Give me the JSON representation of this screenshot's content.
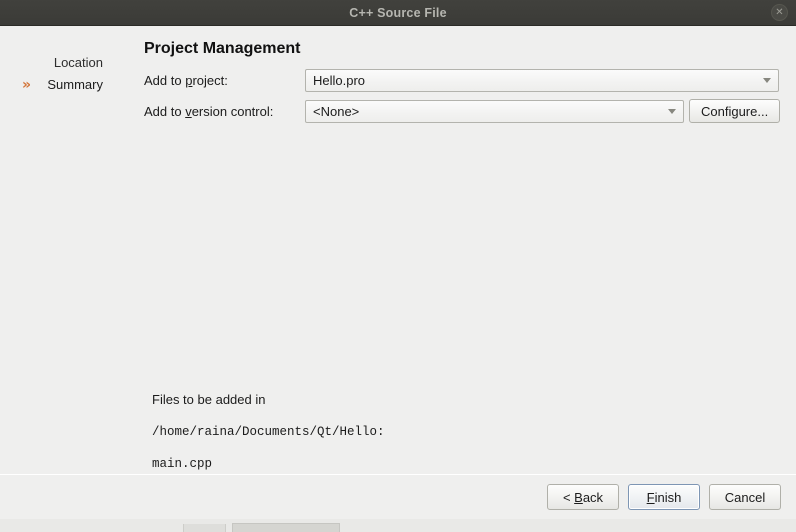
{
  "window": {
    "title": "C++ Source File",
    "close_icon": "close-icon",
    "close_glyph": "✕",
    "titlebar_color": "#3b3b37",
    "body_color": "#efefee",
    "accent_color": "#d3763b"
  },
  "sidebar": {
    "items": [
      {
        "label": "Location",
        "current": false,
        "marker": ""
      },
      {
        "label": "Summary",
        "current": true,
        "marker": "»"
      }
    ]
  },
  "main": {
    "page_title": "Project Management",
    "fields": [
      {
        "label_pre": "Add to ",
        "label_key": "p",
        "label_post": "roject:",
        "value": "Hello.pro",
        "placeholder": "Hello.pro"
      },
      {
        "label_pre": "Add to ",
        "label_key": "v",
        "label_post": "ersion control:",
        "value": "<None>",
        "placeholder": "<None>"
      }
    ],
    "configure_button": "Configure...",
    "summary": {
      "heading": "Files to be added in",
      "path": "/home/raina/Documents/Qt/Hello:",
      "files": "main.cpp"
    }
  },
  "footer": {
    "back": {
      "pre": "< ",
      "key": "B",
      "post": "ack"
    },
    "finish": {
      "pre": "",
      "key": "F",
      "post": "inish"
    },
    "cancel": {
      "pre": "Cancel",
      "key": "",
      "post": ""
    }
  }
}
